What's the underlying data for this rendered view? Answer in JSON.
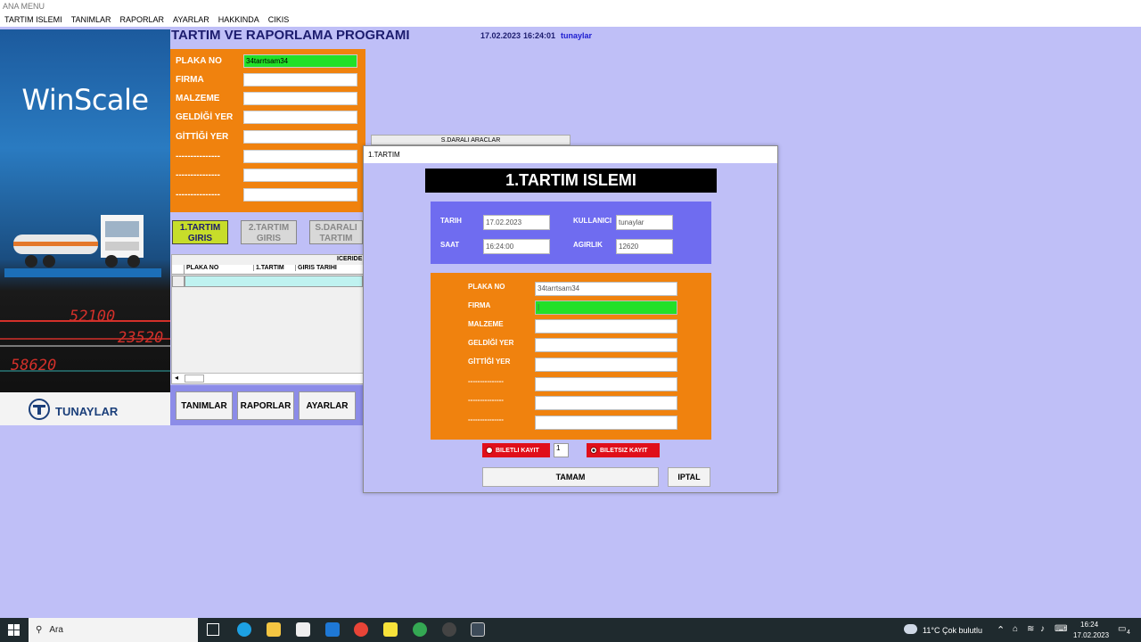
{
  "window": {
    "title": "ANA MENU"
  },
  "menu": [
    "TARTIM ISLEMI",
    "TANIMLAR",
    "RAPORLAR",
    "AYARLAR",
    "HAKKINDA",
    "CIKIS"
  ],
  "banner": {
    "logo": "WinScale",
    "digits": [
      "52100",
      "23520",
      "58620"
    ],
    "brand": "TUNAYLAR"
  },
  "header": {
    "title": "TARTIM VE RAPORLAMA PROGRAMI",
    "date": "17.02.2023",
    "time": "16:24:01",
    "user": "tunaylar"
  },
  "main_form": {
    "fields": [
      {
        "label": "PLAKA NO",
        "value": "34tarrtsam34"
      },
      {
        "label": "FIRMA",
        "value": ""
      },
      {
        "label": "MALZEME",
        "value": ""
      },
      {
        "label": "GELDİĞİ YER",
        "value": ""
      },
      {
        "label": "GİTTİĞİ YER",
        "value": ""
      },
      {
        "label": "---------------",
        "value": ""
      },
      {
        "label": "---------------",
        "value": ""
      },
      {
        "label": "---------------",
        "value": ""
      }
    ]
  },
  "steps": [
    "1.TARTIM GIRIS",
    "2.TARTIM GIRIS",
    "S.DARALI TARTIM"
  ],
  "grid": {
    "caption": "ICERIDE",
    "columns": [
      "PLAKA NO",
      "1.TARTIM",
      "GIRIS TARIHI"
    ]
  },
  "bottom_buttons": [
    "TANIMLAR",
    "RAPORLAR",
    "AYARLAR"
  ],
  "sdarali_panel": {
    "title": "S.DARALI ARACLAR"
  },
  "dialog": {
    "window_title": "1.TARTIM",
    "heading": "1.TARTIM ISLEMI",
    "info": {
      "tarih_label": "TARIH",
      "tarih": "17.02.2023",
      "saat_label": "SAAT",
      "saat": "16:24:00",
      "kullanici_label": "KULLANICI",
      "kullanici": "tunaylar",
      "agirlik_label": "AGIRLIK",
      "agirlik": "12620"
    },
    "fields": [
      {
        "label": "PLAKA NO",
        "value": "34tarrtsam34"
      },
      {
        "label": "FIRMA",
        "value": "|"
      },
      {
        "label": "MALZEME",
        "value": ""
      },
      {
        "label": "GELDİĞİ YER",
        "value": ""
      },
      {
        "label": "GİTTİĞİ YER",
        "value": ""
      },
      {
        "label": "---------------",
        "value": ""
      },
      {
        "label": "---------------",
        "value": ""
      },
      {
        "label": "---------------",
        "value": ""
      }
    ],
    "biletli": "BILETLI KAYIT",
    "ticket_count": "1",
    "biletsiz": "BILETSIZ KAYIT",
    "ok": "TAMAM",
    "cancel": "IPTAL"
  },
  "taskbar": {
    "search": "Ara",
    "weather": "11°C  Çok bulutlu",
    "clock_time": "16:24",
    "clock_date": "17.02.2023",
    "notifications": "4"
  },
  "colors": {
    "accent_green": "#22e028",
    "orange": "#f0820e",
    "form_blue": "#6f6cf0",
    "bg": "#bfbff7",
    "red": "#e00f1a"
  }
}
